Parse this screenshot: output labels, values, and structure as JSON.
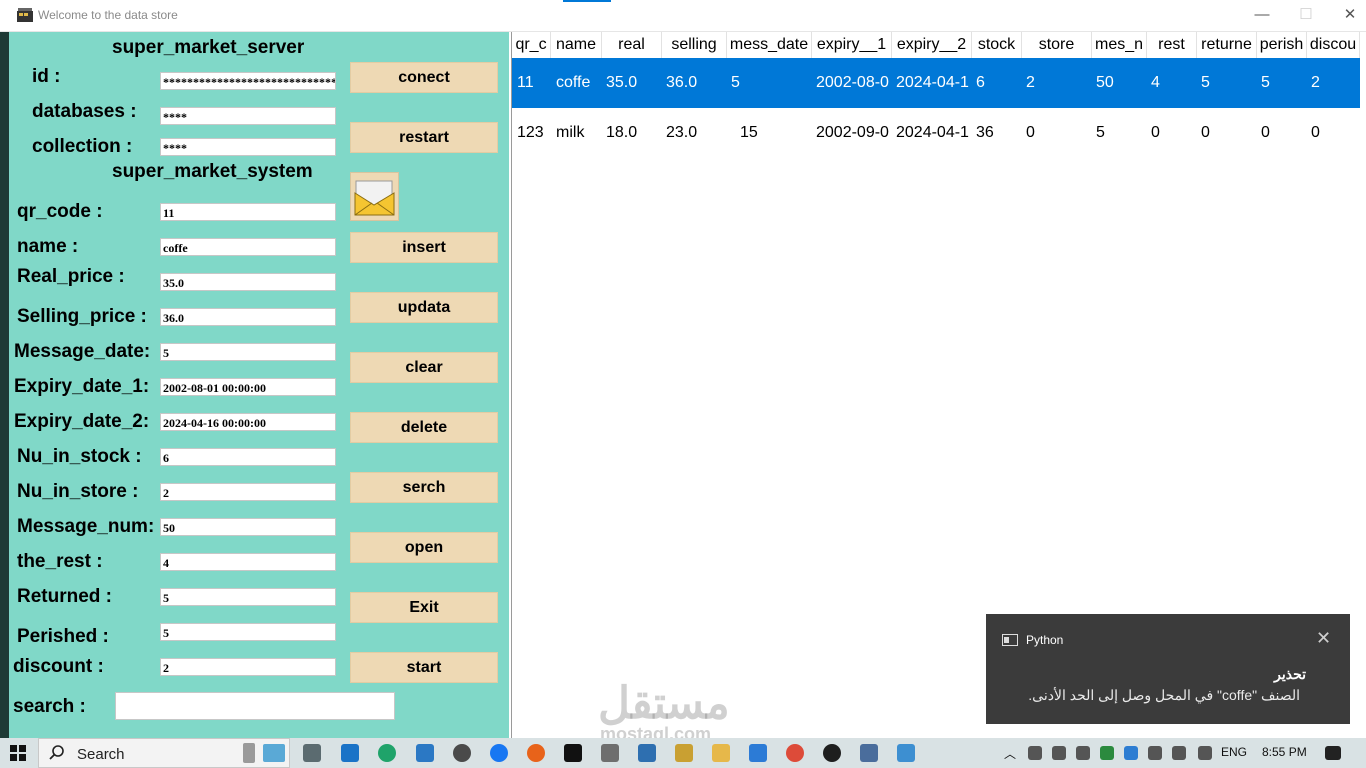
{
  "window": {
    "title": "Welcome to the data store"
  },
  "form": {
    "server_header": "super_market_server",
    "system_header": "super_market_system",
    "server_fields": [
      {
        "label": "id :",
        "value": "**********************************"
      },
      {
        "label": "databases :",
        "value": "****"
      },
      {
        "label": "collection :",
        "value": "****"
      }
    ],
    "fields": [
      {
        "label": "qr_code :",
        "value": "11"
      },
      {
        "label": "name :",
        "value": "coffe"
      },
      {
        "label": "Real_price :",
        "value": "35.0"
      },
      {
        "label": "Selling_price :",
        "value": "36.0"
      },
      {
        "label": "Message_date:",
        "value": "5"
      },
      {
        "label": "Expiry_date_1:",
        "value": "2002-08-01 00:00:00"
      },
      {
        "label": "Expiry_date_2:",
        "value": "2024-04-16 00:00:00"
      },
      {
        "label": "Nu_in_stock :",
        "value": "6"
      },
      {
        "label": "Nu_in_store :",
        "value": "2"
      },
      {
        "label": "Message_num:",
        "value": "50"
      },
      {
        "label": "the_rest :",
        "value": "4"
      },
      {
        "label": "Returned :",
        "value": "5"
      },
      {
        "label": "Perished :",
        "value": "5"
      },
      {
        "label": "discount :",
        "value": "2"
      }
    ],
    "search_label": "search :",
    "search_value": ""
  },
  "buttons": {
    "conect": "conect",
    "restart": "restart",
    "insert": "insert",
    "updata": "updata",
    "clear": "clear",
    "delete": "delete",
    "serch": "serch",
    "open": "open",
    "exit": "Exit",
    "start": "start"
  },
  "table": {
    "columns": [
      "qr_c",
      "name",
      "real",
      "selling",
      "mess_date",
      "expiry__1",
      "expiry__2",
      "stock",
      "store",
      "mes_n",
      "rest",
      "returne",
      "perish",
      "discou"
    ],
    "rows": [
      [
        "11",
        "coffe",
        "35.0",
        "36.0",
        "5",
        "2002-08-0",
        "2024-04-1",
        "6",
        "2",
        "50",
        "4",
        "5",
        "5",
        "2"
      ],
      [
        "123",
        "milk",
        "18.0",
        "23.0",
        "15",
        "2002-09-0",
        "2024-04-1",
        "36",
        "0",
        "5",
        "0",
        "0",
        "0",
        "0"
      ]
    ],
    "selected_row": 0
  },
  "toast": {
    "app": "Python",
    "title": "تحذير",
    "message": "الصنف \"coffe\" في المحل  وصل إلى الحد الأدنى."
  },
  "taskbar": {
    "search": "Search",
    "language": "ENG",
    "time": "8:55 PM"
  },
  "watermark": {
    "text": "مستقل",
    "sub": "mostaql.com"
  },
  "colors": {
    "panel": "#80d8c8",
    "button": "#eed9b4",
    "selection": "#0078d7",
    "toast": "#3b3b3b"
  }
}
